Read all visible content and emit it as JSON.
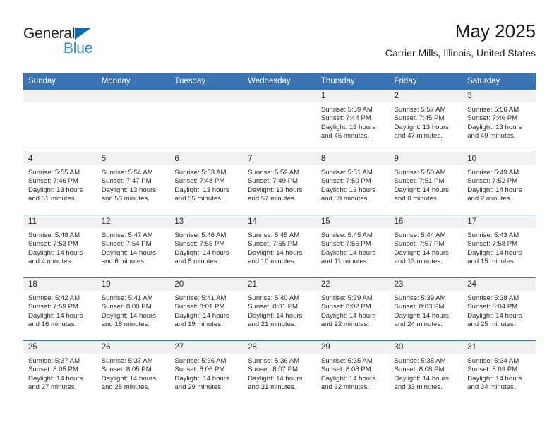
{
  "brand": {
    "name_part1": "General",
    "name_part2": "Blue",
    "triangle_color": "#0c68b0",
    "blue_color": "#2e8bd8"
  },
  "header": {
    "title": "May 2025",
    "subtitle": "Carrier Mills, Illinois, United States"
  },
  "theme": {
    "header_blue": "#3a74b5",
    "date_band_gray": "#f1f1f1",
    "text_color": "#2a2a2a"
  },
  "weekdays": [
    "Sunday",
    "Monday",
    "Tuesday",
    "Wednesday",
    "Thursday",
    "Friday",
    "Saturday"
  ],
  "weeks": [
    [
      {
        "day": "",
        "lines": []
      },
      {
        "day": "",
        "lines": []
      },
      {
        "day": "",
        "lines": []
      },
      {
        "day": "",
        "lines": []
      },
      {
        "day": "1",
        "lines": [
          "Sunrise: 5:59 AM",
          "Sunset: 7:44 PM",
          "Daylight: 13 hours",
          "and 45 minutes."
        ]
      },
      {
        "day": "2",
        "lines": [
          "Sunrise: 5:57 AM",
          "Sunset: 7:45 PM",
          "Daylight: 13 hours",
          "and 47 minutes."
        ]
      },
      {
        "day": "3",
        "lines": [
          "Sunrise: 5:56 AM",
          "Sunset: 7:46 PM",
          "Daylight: 13 hours",
          "and 49 minutes."
        ]
      }
    ],
    [
      {
        "day": "4",
        "lines": [
          "Sunrise: 5:55 AM",
          "Sunset: 7:46 PM",
          "Daylight: 13 hours",
          "and 51 minutes."
        ]
      },
      {
        "day": "5",
        "lines": [
          "Sunrise: 5:54 AM",
          "Sunset: 7:47 PM",
          "Daylight: 13 hours",
          "and 53 minutes."
        ]
      },
      {
        "day": "6",
        "lines": [
          "Sunrise: 5:53 AM",
          "Sunset: 7:48 PM",
          "Daylight: 13 hours",
          "and 55 minutes."
        ]
      },
      {
        "day": "7",
        "lines": [
          "Sunrise: 5:52 AM",
          "Sunset: 7:49 PM",
          "Daylight: 13 hours",
          "and 57 minutes."
        ]
      },
      {
        "day": "8",
        "lines": [
          "Sunrise: 5:51 AM",
          "Sunset: 7:50 PM",
          "Daylight: 13 hours",
          "and 59 minutes."
        ]
      },
      {
        "day": "9",
        "lines": [
          "Sunrise: 5:50 AM",
          "Sunset: 7:51 PM",
          "Daylight: 14 hours",
          "and 0 minutes."
        ]
      },
      {
        "day": "10",
        "lines": [
          "Sunrise: 5:49 AM",
          "Sunset: 7:52 PM",
          "Daylight: 14 hours",
          "and 2 minutes."
        ]
      }
    ],
    [
      {
        "day": "11",
        "lines": [
          "Sunrise: 5:48 AM",
          "Sunset: 7:53 PM",
          "Daylight: 14 hours",
          "and 4 minutes."
        ]
      },
      {
        "day": "12",
        "lines": [
          "Sunrise: 5:47 AM",
          "Sunset: 7:54 PM",
          "Daylight: 14 hours",
          "and 6 minutes."
        ]
      },
      {
        "day": "13",
        "lines": [
          "Sunrise: 5:46 AM",
          "Sunset: 7:55 PM",
          "Daylight: 14 hours",
          "and 8 minutes."
        ]
      },
      {
        "day": "14",
        "lines": [
          "Sunrise: 5:45 AM",
          "Sunset: 7:55 PM",
          "Daylight: 14 hours",
          "and 10 minutes."
        ]
      },
      {
        "day": "15",
        "lines": [
          "Sunrise: 5:45 AM",
          "Sunset: 7:56 PM",
          "Daylight: 14 hours",
          "and 11 minutes."
        ]
      },
      {
        "day": "16",
        "lines": [
          "Sunrise: 5:44 AM",
          "Sunset: 7:57 PM",
          "Daylight: 14 hours",
          "and 13 minutes."
        ]
      },
      {
        "day": "17",
        "lines": [
          "Sunrise: 5:43 AM",
          "Sunset: 7:58 PM",
          "Daylight: 14 hours",
          "and 15 minutes."
        ]
      }
    ],
    [
      {
        "day": "18",
        "lines": [
          "Sunrise: 5:42 AM",
          "Sunset: 7:59 PM",
          "Daylight: 14 hours",
          "and 16 minutes."
        ]
      },
      {
        "day": "19",
        "lines": [
          "Sunrise: 5:41 AM",
          "Sunset: 8:00 PM",
          "Daylight: 14 hours",
          "and 18 minutes."
        ]
      },
      {
        "day": "20",
        "lines": [
          "Sunrise: 5:41 AM",
          "Sunset: 8:01 PM",
          "Daylight: 14 hours",
          "and 19 minutes."
        ]
      },
      {
        "day": "21",
        "lines": [
          "Sunrise: 5:40 AM",
          "Sunset: 8:01 PM",
          "Daylight: 14 hours",
          "and 21 minutes."
        ]
      },
      {
        "day": "22",
        "lines": [
          "Sunrise: 5:39 AM",
          "Sunset: 8:02 PM",
          "Daylight: 14 hours",
          "and 22 minutes."
        ]
      },
      {
        "day": "23",
        "lines": [
          "Sunrise: 5:39 AM",
          "Sunset: 8:03 PM",
          "Daylight: 14 hours",
          "and 24 minutes."
        ]
      },
      {
        "day": "24",
        "lines": [
          "Sunrise: 5:38 AM",
          "Sunset: 8:04 PM",
          "Daylight: 14 hours",
          "and 25 minutes."
        ]
      }
    ],
    [
      {
        "day": "25",
        "lines": [
          "Sunrise: 5:37 AM",
          "Sunset: 8:05 PM",
          "Daylight: 14 hours",
          "and 27 minutes."
        ]
      },
      {
        "day": "26",
        "lines": [
          "Sunrise: 5:37 AM",
          "Sunset: 8:05 PM",
          "Daylight: 14 hours",
          "and 28 minutes."
        ]
      },
      {
        "day": "27",
        "lines": [
          "Sunrise: 5:36 AM",
          "Sunset: 8:06 PM",
          "Daylight: 14 hours",
          "and 29 minutes."
        ]
      },
      {
        "day": "28",
        "lines": [
          "Sunrise: 5:36 AM",
          "Sunset: 8:07 PM",
          "Daylight: 14 hours",
          "and 31 minutes."
        ]
      },
      {
        "day": "29",
        "lines": [
          "Sunrise: 5:35 AM",
          "Sunset: 8:08 PM",
          "Daylight: 14 hours",
          "and 32 minutes."
        ]
      },
      {
        "day": "30",
        "lines": [
          "Sunrise: 5:35 AM",
          "Sunset: 8:08 PM",
          "Daylight: 14 hours",
          "and 33 minutes."
        ]
      },
      {
        "day": "31",
        "lines": [
          "Sunrise: 5:34 AM",
          "Sunset: 8:09 PM",
          "Daylight: 14 hours",
          "and 34 minutes."
        ]
      }
    ]
  ]
}
